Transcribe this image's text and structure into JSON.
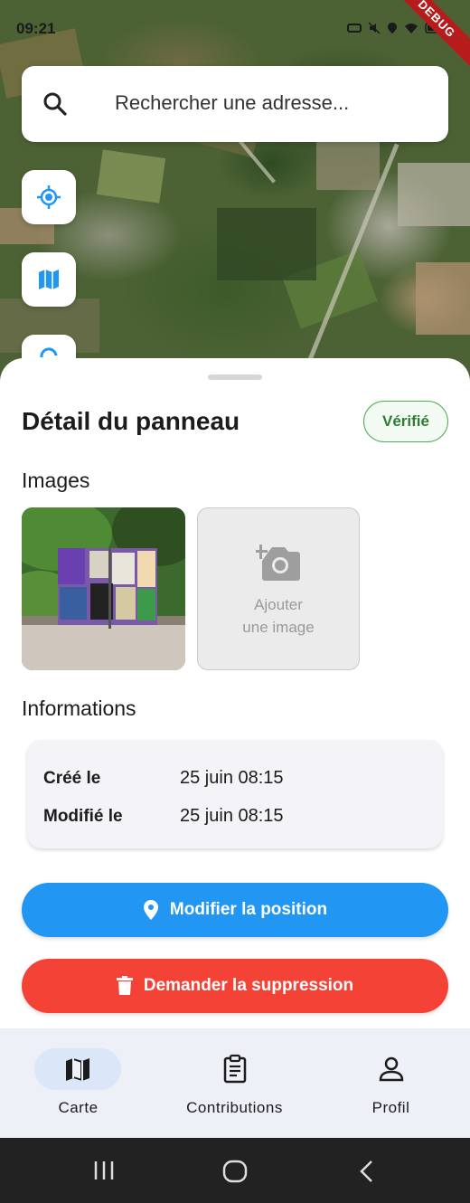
{
  "status_bar": {
    "time": "09:21",
    "icons": [
      "sim-icon",
      "mute-icon",
      "location-icon",
      "wifi-icon",
      "battery-icon"
    ],
    "debug_label": "DEBUG"
  },
  "search": {
    "placeholder": "Rechercher une adresse..."
  },
  "map_controls": [
    "my-location-icon",
    "map-layers-icon",
    "refresh-icon"
  ],
  "sheet": {
    "title": "Détail du panneau",
    "status_badge": "Vérifié",
    "images_heading": "Images",
    "add_image_label": "Ajouter\nune image",
    "info_heading": "Informations",
    "info": [
      {
        "label": "Créé le",
        "value": "25 juin 08:15"
      },
      {
        "label": "Modifié le",
        "value": "25 juin 08:15"
      }
    ],
    "modify_button": "Modifier la position",
    "delete_button": "Demander la suppression"
  },
  "bottom_nav": {
    "items": [
      {
        "label": "Carte",
        "icon": "map-icon",
        "active": true
      },
      {
        "label": "Contributions",
        "icon": "clipboard-icon",
        "active": false
      },
      {
        "label": "Profil",
        "icon": "person-icon",
        "active": false
      }
    ]
  },
  "colors": {
    "primary": "#2196f3",
    "danger": "#f44336",
    "verified": "#4caf50",
    "nav_active": "#dbe6f8"
  }
}
